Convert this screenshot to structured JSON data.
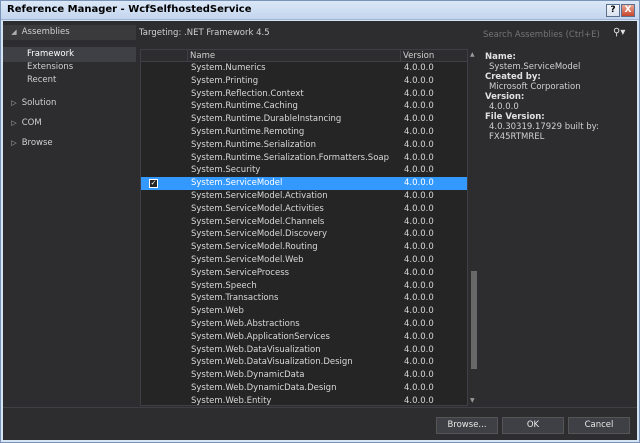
{
  "window": {
    "title": "Reference Manager - WcfSelfhostedService",
    "help_label": "?",
    "close_label": "X"
  },
  "nav": {
    "assemblies": "Assemblies",
    "sub_items": [
      "Framework",
      "Extensions",
      "Recent"
    ],
    "groups": [
      "Solution",
      "COM",
      "Browse"
    ]
  },
  "topbar": {
    "targeting": "Targeting: .NET Framework 4.5",
    "search_placeholder": "Search Assemblies (Ctrl+E)"
  },
  "grid": {
    "col_name": "Name",
    "col_version": "Version",
    "selected_index": 9,
    "rows": [
      {
        "name": "System.Numerics",
        "version": "4.0.0.0"
      },
      {
        "name": "System.Printing",
        "version": "4.0.0.0"
      },
      {
        "name": "System.Reflection.Context",
        "version": "4.0.0.0"
      },
      {
        "name": "System.Runtime.Caching",
        "version": "4.0.0.0"
      },
      {
        "name": "System.Runtime.DurableInstancing",
        "version": "4.0.0.0"
      },
      {
        "name": "System.Runtime.Remoting",
        "version": "4.0.0.0"
      },
      {
        "name": "System.Runtime.Serialization",
        "version": "4.0.0.0"
      },
      {
        "name": "System.Runtime.Serialization.Formatters.Soap",
        "version": "4.0.0.0"
      },
      {
        "name": "System.Security",
        "version": "4.0.0.0"
      },
      {
        "name": "System.ServiceModel",
        "version": "4.0.0.0",
        "checked": true
      },
      {
        "name": "System.ServiceModel.Activation",
        "version": "4.0.0.0"
      },
      {
        "name": "System.ServiceModel.Activities",
        "version": "4.0.0.0"
      },
      {
        "name": "System.ServiceModel.Channels",
        "version": "4.0.0.0"
      },
      {
        "name": "System.ServiceModel.Discovery",
        "version": "4.0.0.0"
      },
      {
        "name": "System.ServiceModel.Routing",
        "version": "4.0.0.0"
      },
      {
        "name": "System.ServiceModel.Web",
        "version": "4.0.0.0"
      },
      {
        "name": "System.ServiceProcess",
        "version": "4.0.0.0"
      },
      {
        "name": "System.Speech",
        "version": "4.0.0.0"
      },
      {
        "name": "System.Transactions",
        "version": "4.0.0.0"
      },
      {
        "name": "System.Web",
        "version": "4.0.0.0"
      },
      {
        "name": "System.Web.Abstractions",
        "version": "4.0.0.0"
      },
      {
        "name": "System.Web.ApplicationServices",
        "version": "4.0.0.0"
      },
      {
        "name": "System.Web.DataVisualization",
        "version": "4.0.0.0"
      },
      {
        "name": "System.Web.DataVisualization.Design",
        "version": "4.0.0.0"
      },
      {
        "name": "System.Web.DynamicData",
        "version": "4.0.0.0"
      },
      {
        "name": "System.Web.DynamicData.Design",
        "version": "4.0.0.0"
      },
      {
        "name": "System.Web.Entity",
        "version": "4.0.0.0"
      }
    ]
  },
  "details": {
    "name_label": "Name:",
    "name_value": "System.ServiceModel",
    "created_label": "Created by:",
    "created_value": "Microsoft Corporation",
    "version_label": "Version:",
    "version_value": "4.0.0.0",
    "file_version_label": "File Version:",
    "file_version_value_1": "4.0.30319.17929 built by:",
    "file_version_value_2": "FX45RTMREL"
  },
  "footer": {
    "browse": "Browse...",
    "ok": "OK",
    "cancel": "Cancel"
  },
  "colors": {
    "selection": "#3399ff",
    "background": "#2d2d30"
  }
}
